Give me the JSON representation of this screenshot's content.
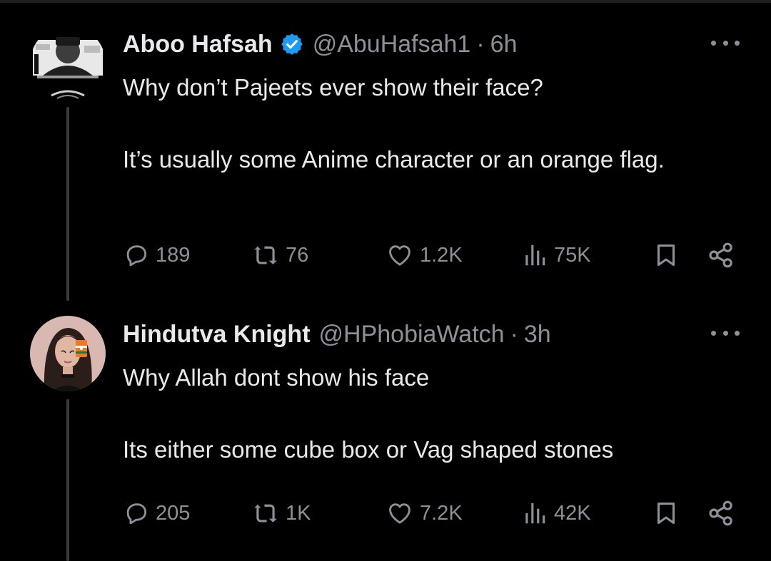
{
  "tweets": [
    {
      "author_name": "Aboo Hafsah",
      "handle": "@AbuHafsah1",
      "separator": "·",
      "time": "6h",
      "verified": true,
      "text_paragraphs": [
        "Why don’t Pajeets ever show their face?",
        "It’s usually some Anime character or an orange flag."
      ],
      "stats": {
        "replies": "189",
        "reposts": "76",
        "likes": "1.2K",
        "views": "75K"
      }
    },
    {
      "author_name": "Hindutva Knight",
      "handle": "@HPhobiaWatch",
      "separator": "·",
      "time": "3h",
      "verified": false,
      "text_paragraphs": [
        "Why Allah dont show his face",
        "Its either some cube box or Vag shaped stones"
      ],
      "stats": {
        "replies": "205",
        "reposts": "1K",
        "likes": "7.2K",
        "views": "42K"
      }
    }
  ],
  "icons": {
    "reply": "speech-bubble-icon",
    "repost": "repost-arrows-icon",
    "like": "heart-icon",
    "views": "bar-chart-icon",
    "bookmark": "bookmark-icon",
    "share": "share-nodes-icon",
    "more": "more-dots-icon",
    "verified": "verified-badge-icon"
  },
  "colors": {
    "background": "#000000",
    "text": "#e7e9ea",
    "secondary": "#8b9198",
    "verified": "#1d9bf0"
  }
}
